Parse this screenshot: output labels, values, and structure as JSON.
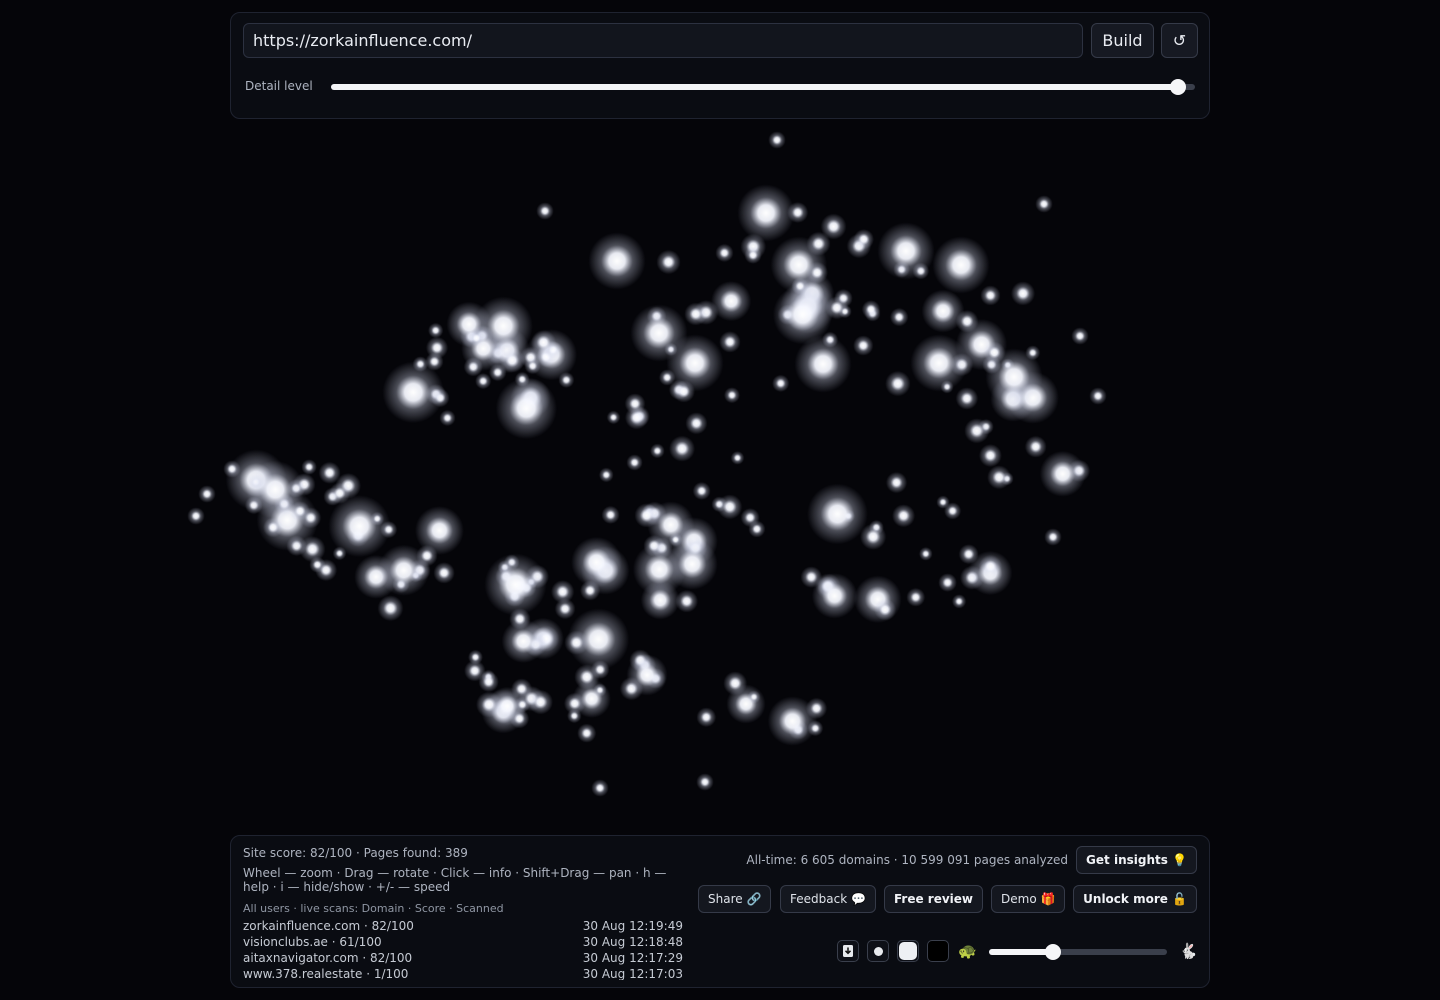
{
  "toolbar": {
    "url_value": "https://zorkainfluence.com/",
    "url_placeholder": "https://zorkainfluence.com/",
    "build_label": "Build",
    "reset_label": "↺",
    "detail_label": "Detail level",
    "detail_level": 0.98
  },
  "stats": {
    "site_score": "Site score: 82/100 · Pages found: 389",
    "help": "Wheel — zoom · Drag — rotate · Click — info · Shift+Drag — pan · h — help · i — hide/show · +/- — speed",
    "alltime": "All-time: 6 605 domains · 10 599 091 pages analyzed"
  },
  "scans": {
    "header": "All users · live scans: Domain · Score · Scanned",
    "rows": [
      {
        "domain": "zorkainfluence.com · 82/100",
        "time": "30 Aug 12:19:49"
      },
      {
        "domain": "visionclubs.ae · 61/100",
        "time": "30 Aug 12:18:48"
      },
      {
        "domain": "aitaxnavigator.com · 82/100",
        "time": "30 Aug 12:17:29"
      },
      {
        "domain": "www.378.realestate · 1/100",
        "time": "30 Aug 12:17:03"
      }
    ]
  },
  "buttons": {
    "insights": "Get insights 💡",
    "share": "Share 🔗",
    "feedback": "Feedback 💬",
    "review": "Free review",
    "demo": "Demo 🎁",
    "unlock": "Unlock more 🔓"
  },
  "controls": {
    "turtle": "🐢",
    "rabbit": "🐇",
    "speed_level": 0.36,
    "icons": [
      "download-icon",
      "dot-small-icon",
      "dot-large-white-icon",
      "dot-black-icon"
    ]
  },
  "colors": {
    "background": "#050509",
    "glow": "#ffffff",
    "panel": "#0a0c12"
  }
}
